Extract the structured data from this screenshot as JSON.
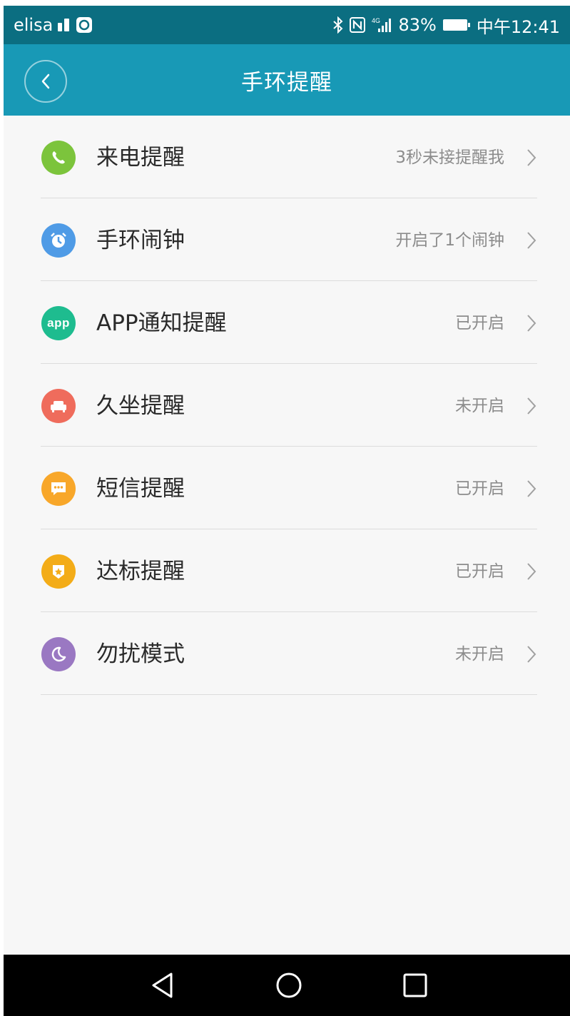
{
  "status_bar": {
    "carrier": "elisa",
    "battery": "83%",
    "time": "中午12:41",
    "network": "4G"
  },
  "header": {
    "title": "手环提醒"
  },
  "items": [
    {
      "label": "来电提醒",
      "status": "3秒未接提醒我",
      "icon": "phone-icon",
      "color": "#7cc43c"
    },
    {
      "label": "手环闹钟",
      "status": "开启了1个闹钟",
      "icon": "alarm-clock-icon",
      "color": "#4f9be6"
    },
    {
      "label": "APP通知提醒",
      "status": "已开启",
      "icon": "app-icon",
      "icon_text": "app",
      "color": "#1ebc8f"
    },
    {
      "label": "久坐提醒",
      "status": "未开启",
      "icon": "sofa-icon",
      "color": "#ef6c5c"
    },
    {
      "label": "短信提醒",
      "status": "已开启",
      "icon": "message-icon",
      "color": "#f8a72a"
    },
    {
      "label": "达标提醒",
      "status": "已开启",
      "icon": "medal-icon",
      "color": "#f3ac18"
    },
    {
      "label": "勿扰模式",
      "status": "未开启",
      "icon": "moon-icon",
      "color": "#9a78c2"
    }
  ]
}
